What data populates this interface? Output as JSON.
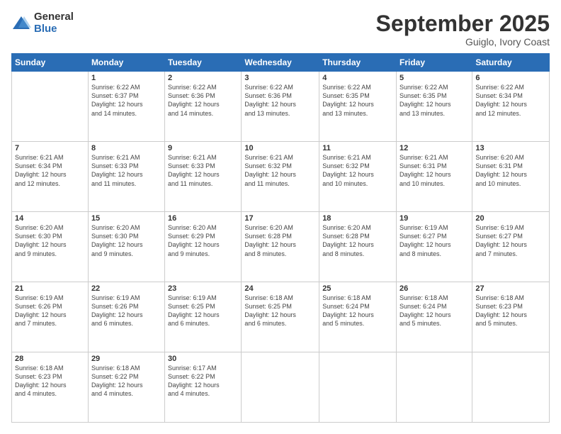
{
  "logo": {
    "general": "General",
    "blue": "Blue"
  },
  "header": {
    "month": "September 2025",
    "location": "Guiglo, Ivory Coast"
  },
  "days_of_week": [
    "Sunday",
    "Monday",
    "Tuesday",
    "Wednesday",
    "Thursday",
    "Friday",
    "Saturday"
  ],
  "weeks": [
    [
      {
        "num": "",
        "info": ""
      },
      {
        "num": "1",
        "info": "Sunrise: 6:22 AM\nSunset: 6:37 PM\nDaylight: 12 hours\nand 14 minutes."
      },
      {
        "num": "2",
        "info": "Sunrise: 6:22 AM\nSunset: 6:36 PM\nDaylight: 12 hours\nand 14 minutes."
      },
      {
        "num": "3",
        "info": "Sunrise: 6:22 AM\nSunset: 6:36 PM\nDaylight: 12 hours\nand 13 minutes."
      },
      {
        "num": "4",
        "info": "Sunrise: 6:22 AM\nSunset: 6:35 PM\nDaylight: 12 hours\nand 13 minutes."
      },
      {
        "num": "5",
        "info": "Sunrise: 6:22 AM\nSunset: 6:35 PM\nDaylight: 12 hours\nand 13 minutes."
      },
      {
        "num": "6",
        "info": "Sunrise: 6:22 AM\nSunset: 6:34 PM\nDaylight: 12 hours\nand 12 minutes."
      }
    ],
    [
      {
        "num": "7",
        "info": "Sunrise: 6:21 AM\nSunset: 6:34 PM\nDaylight: 12 hours\nand 12 minutes."
      },
      {
        "num": "8",
        "info": "Sunrise: 6:21 AM\nSunset: 6:33 PM\nDaylight: 12 hours\nand 11 minutes."
      },
      {
        "num": "9",
        "info": "Sunrise: 6:21 AM\nSunset: 6:33 PM\nDaylight: 12 hours\nand 11 minutes."
      },
      {
        "num": "10",
        "info": "Sunrise: 6:21 AM\nSunset: 6:32 PM\nDaylight: 12 hours\nand 11 minutes."
      },
      {
        "num": "11",
        "info": "Sunrise: 6:21 AM\nSunset: 6:32 PM\nDaylight: 12 hours\nand 10 minutes."
      },
      {
        "num": "12",
        "info": "Sunrise: 6:21 AM\nSunset: 6:31 PM\nDaylight: 12 hours\nand 10 minutes."
      },
      {
        "num": "13",
        "info": "Sunrise: 6:20 AM\nSunset: 6:31 PM\nDaylight: 12 hours\nand 10 minutes."
      }
    ],
    [
      {
        "num": "14",
        "info": "Sunrise: 6:20 AM\nSunset: 6:30 PM\nDaylight: 12 hours\nand 9 minutes."
      },
      {
        "num": "15",
        "info": "Sunrise: 6:20 AM\nSunset: 6:30 PM\nDaylight: 12 hours\nand 9 minutes."
      },
      {
        "num": "16",
        "info": "Sunrise: 6:20 AM\nSunset: 6:29 PM\nDaylight: 12 hours\nand 9 minutes."
      },
      {
        "num": "17",
        "info": "Sunrise: 6:20 AM\nSunset: 6:28 PM\nDaylight: 12 hours\nand 8 minutes."
      },
      {
        "num": "18",
        "info": "Sunrise: 6:20 AM\nSunset: 6:28 PM\nDaylight: 12 hours\nand 8 minutes."
      },
      {
        "num": "19",
        "info": "Sunrise: 6:19 AM\nSunset: 6:27 PM\nDaylight: 12 hours\nand 8 minutes."
      },
      {
        "num": "20",
        "info": "Sunrise: 6:19 AM\nSunset: 6:27 PM\nDaylight: 12 hours\nand 7 minutes."
      }
    ],
    [
      {
        "num": "21",
        "info": "Sunrise: 6:19 AM\nSunset: 6:26 PM\nDaylight: 12 hours\nand 7 minutes."
      },
      {
        "num": "22",
        "info": "Sunrise: 6:19 AM\nSunset: 6:26 PM\nDaylight: 12 hours\nand 6 minutes."
      },
      {
        "num": "23",
        "info": "Sunrise: 6:19 AM\nSunset: 6:25 PM\nDaylight: 12 hours\nand 6 minutes."
      },
      {
        "num": "24",
        "info": "Sunrise: 6:18 AM\nSunset: 6:25 PM\nDaylight: 12 hours\nand 6 minutes."
      },
      {
        "num": "25",
        "info": "Sunrise: 6:18 AM\nSunset: 6:24 PM\nDaylight: 12 hours\nand 5 minutes."
      },
      {
        "num": "26",
        "info": "Sunrise: 6:18 AM\nSunset: 6:24 PM\nDaylight: 12 hours\nand 5 minutes."
      },
      {
        "num": "27",
        "info": "Sunrise: 6:18 AM\nSunset: 6:23 PM\nDaylight: 12 hours\nand 5 minutes."
      }
    ],
    [
      {
        "num": "28",
        "info": "Sunrise: 6:18 AM\nSunset: 6:23 PM\nDaylight: 12 hours\nand 4 minutes."
      },
      {
        "num": "29",
        "info": "Sunrise: 6:18 AM\nSunset: 6:22 PM\nDaylight: 12 hours\nand 4 minutes."
      },
      {
        "num": "30",
        "info": "Sunrise: 6:17 AM\nSunset: 6:22 PM\nDaylight: 12 hours\nand 4 minutes."
      },
      {
        "num": "",
        "info": ""
      },
      {
        "num": "",
        "info": ""
      },
      {
        "num": "",
        "info": ""
      },
      {
        "num": "",
        "info": ""
      }
    ]
  ]
}
